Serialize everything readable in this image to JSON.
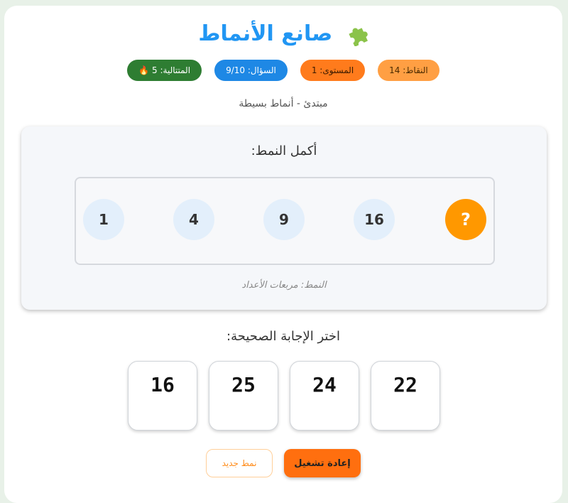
{
  "title": "صانع الأنماط",
  "title_icon": "puzzle-piece-icon",
  "stats": {
    "points": "النقاط: 14",
    "level": "المستوى: 1",
    "question": "السؤال: 9/10",
    "streak": "المتتالية: 5 🔥"
  },
  "subtitle": "مبتدئ - أنماط بسيطة",
  "pattern": {
    "prompt": "أكمل النمط:",
    "sequence": [
      "1",
      "4",
      "9",
      "16",
      "?"
    ],
    "hint": "النمط: مربعات الأعداد"
  },
  "choose_label": "اختر الإجابة الصحيحة:",
  "options": [
    "22",
    "24",
    "25",
    "16"
  ],
  "buttons": {
    "restart": "إعادة تشغيل",
    "new_pattern": "نمط جديد"
  },
  "colors": {
    "title": "#2196f3",
    "accent_orange": "#ff9800",
    "question_badge": "#1e88e5",
    "streak_badge": "#2e7d32"
  }
}
